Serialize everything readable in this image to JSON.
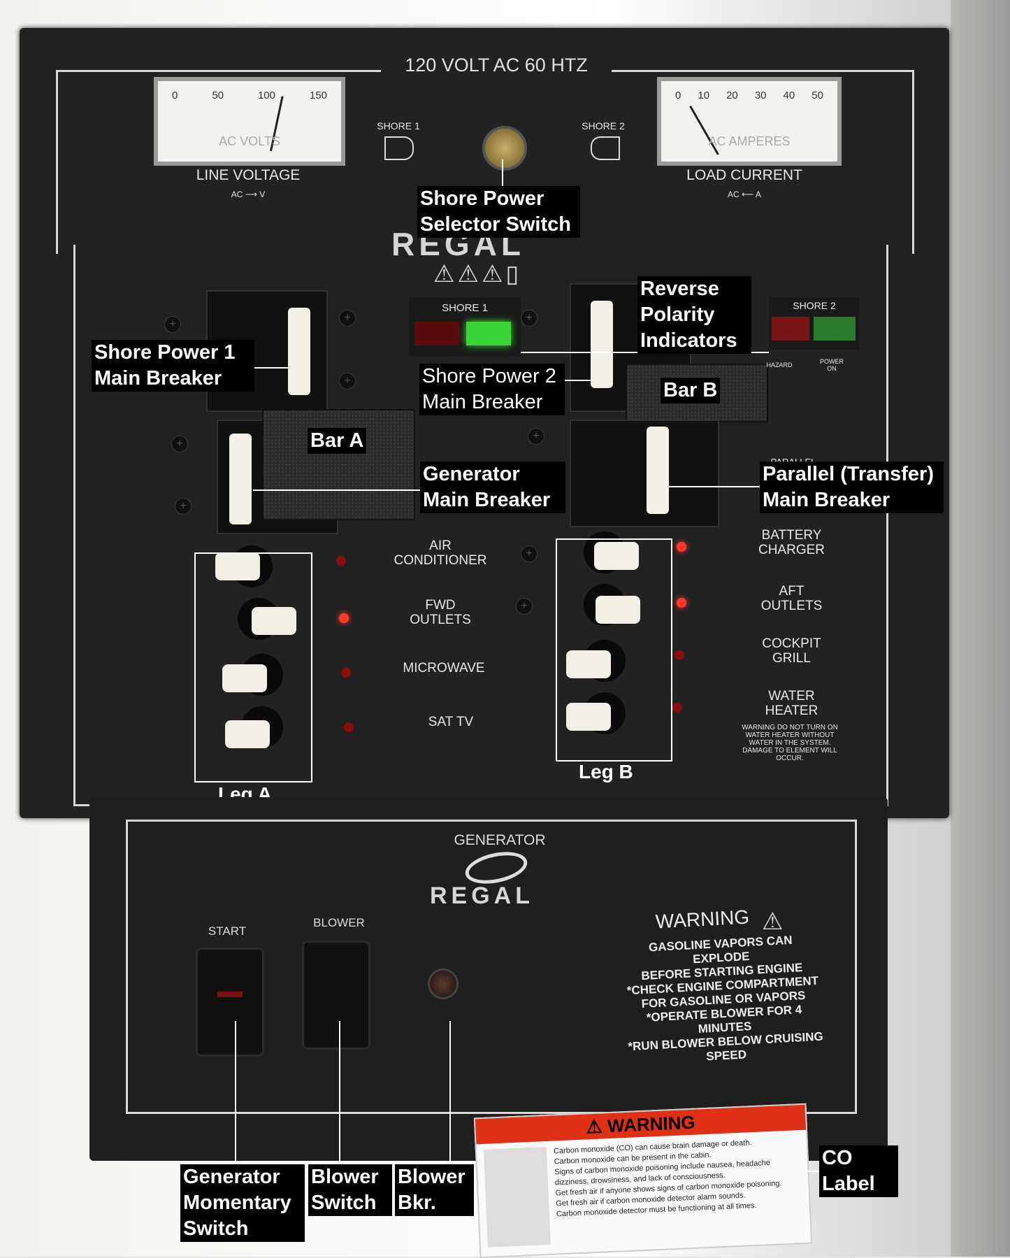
{
  "panel": {
    "header": "120 VOLT AC 60 HTZ",
    "brand": "REGAL",
    "line_voltage_meter": {
      "ticks": [
        "0",
        "50",
        "100",
        "150"
      ],
      "unit": "AC VOLTS",
      "label": "LINE VOLTAGE",
      "sublabel": "AC ⟶ V"
    },
    "load_current_meter": {
      "ticks": [
        "0",
        "10",
        "20",
        "30",
        "40",
        "50"
      ],
      "unit": "AC AMPERES",
      "label": "LOAD CURRENT",
      "sublabel": "AC ⟵ A"
    },
    "shore1_label": "SHORE 1",
    "shore2_label": "SHORE 2",
    "shore1_indicator_label": "SHORE 1",
    "shore2_indicator_label": "SHORE 2",
    "hazard_label": "HAZARD",
    "power_label": "POWER",
    "power_on_label": "POWER ON",
    "parallel_label": "PARALLEL",
    "leg_a_circuits": [
      "AIR CONDITIONER",
      "FWD OUTLETS",
      "MICROWAVE",
      "SAT TV"
    ],
    "leg_b_circuits": [
      "BATTERY CHARGER",
      "AFT OUTLETS",
      "COCKPIT GRILL",
      "WATER HEATER"
    ],
    "water_heater_warning": "WARNING DO NOT TURN ON WATER HEATER WITHOUT WATER IN THE SYSTEM. DAMAGE TO ELEMENT WILL OCCUR."
  },
  "generator": {
    "title": "GENERATOR",
    "brand": "REGAL",
    "start_label": "START",
    "blower_label": "BLOWER",
    "warning_title": "WARNING",
    "warning_lines": [
      "GASOLINE VAPORS CAN EXPLODE",
      "BEFORE STARTING ENGINE",
      "*CHECK ENGINE COMPARTMENT",
      "FOR GASOLINE OR VAPORS",
      "*OPERATE BLOWER FOR 4 MINUTES",
      "*RUN BLOWER BELOW CRUISING SPEED"
    ]
  },
  "co_label": {
    "title": "WARNING",
    "lines": [
      "Carbon monoxide (CO) can cause brain damage or death.",
      "Carbon monoxide can be present in the cabin.",
      "Carbon monoxide poisoning include nausea, headache",
      "Signs of carbon monoxide poisoning include nausea, headache",
      "dizziness, drowsiness, and lack of consciousness.",
      "Get fresh air if anyone shows signs of carbon monoxide poisoning.",
      "Get fresh air if carbon monoxide detector alarm sounds.",
      "Carbon monoxide detector must be functioning at all times."
    ]
  },
  "annotations": {
    "shore_power_selector": "Shore Power Selector Switch",
    "shore_power_1_breaker": "Shore Power 1 Main Breaker",
    "reverse_polarity": "Reverse Polarity Indicators",
    "shore_power_2_breaker": "Shore Power 2 Main Breaker",
    "bar_b": "Bar B",
    "bar_a": "Bar A",
    "generator_breaker": "Generator Main Breaker",
    "parallel_breaker": "Parallel (Transfer) Main Breaker",
    "leg_a": "Leg A",
    "leg_b": "Leg B",
    "generator_switch": "Generator Momentary Switch",
    "blower_switch": "Blower Switch",
    "blower_breaker": "Blower Bkr.",
    "co_label": "CO Label"
  }
}
